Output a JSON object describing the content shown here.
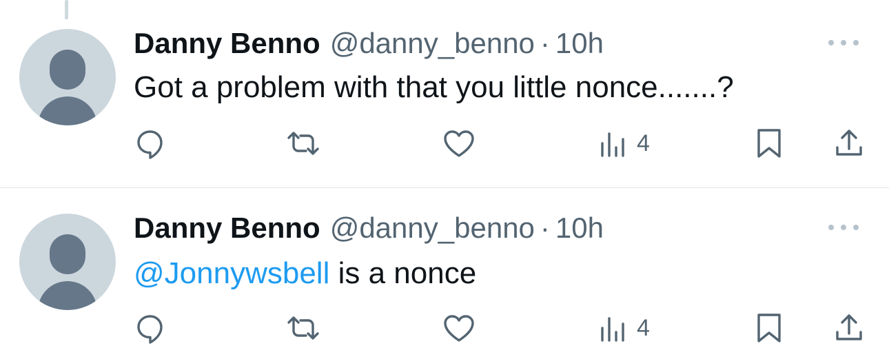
{
  "tweets": [
    {
      "display_name": "Danny Benno",
      "handle": "@danny_benno",
      "separator": "·",
      "time": "10h",
      "text_mention": "",
      "text": "Got a problem with that you little nonce.......?",
      "views": "4",
      "icons": [
        "reply-icon",
        "retweet-icon",
        "like-icon",
        "views-icon",
        "bookmark-icon",
        "share-icon",
        "more-icon"
      ]
    },
    {
      "display_name": "Danny Benno",
      "handle": "@danny_benno",
      "separator": "·",
      "time": "10h",
      "text_mention": "@Jonnywsbell",
      "text": " is a nonce",
      "views": "4",
      "icons": [
        "reply-icon",
        "retweet-icon",
        "like-icon",
        "views-icon",
        "bookmark-icon",
        "share-icon",
        "more-icon"
      ]
    }
  ],
  "colors": {
    "mention": "#1d9bf0",
    "secondary_text": "#536471",
    "avatar_bg": "#ccd6dd",
    "avatar_fg": "#66778a"
  }
}
